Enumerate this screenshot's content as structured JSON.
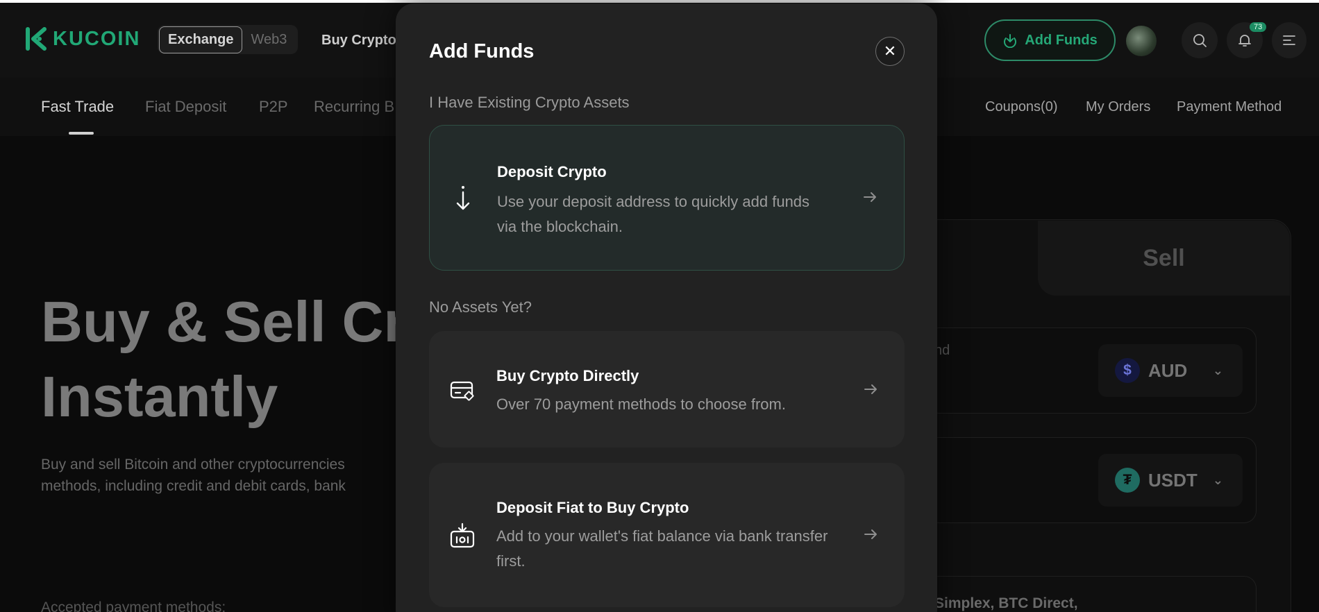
{
  "header": {
    "logo_text": "KUCOIN",
    "switch_exchange": "Exchange",
    "switch_web3": "Web3",
    "nav_buy_crypto": "Buy Crypto",
    "add_funds_label": "Add Funds",
    "notification_count": "73"
  },
  "subnav": {
    "tabs": [
      "Fast Trade",
      "Fiat Deposit",
      "P2P",
      "Recurring B"
    ],
    "active_tab": "Fast Trade",
    "right_links": [
      "Coupons(0)",
      "My Orders",
      "Payment Method"
    ]
  },
  "hero": {
    "title_line1": "Buy & Sell Cr",
    "title_line2": "Instantly",
    "desc_line1": "Buy and sell Bitcoin and other cryptocurrencies",
    "desc_line2": "methods, including credit and debit cards, bank",
    "accepted_label": "Accepted payment methods:"
  },
  "trade_panel": {
    "sell_tab": "Sell",
    "spend_label_fragment": "nd",
    "fiat_currency": "AUD",
    "crypto_currency": "USDT",
    "providers_fragment": "Simplex, BTC Direct,"
  },
  "modal": {
    "title": "Add Funds",
    "section_existing": "I Have Existing Crypto Assets",
    "section_none": "No Assets Yet?",
    "options": [
      {
        "title": "Deposit Crypto",
        "desc": "Use your deposit address to quickly add funds via the blockchain."
      },
      {
        "title": "Buy Crypto Directly",
        "desc": "Over 70 payment methods to choose from."
      },
      {
        "title": "Deposit Fiat to Buy Crypto",
        "desc": "Add to your wallet's fiat balance via bank transfer first."
      }
    ]
  },
  "colors": {
    "brand_green": "#21a876",
    "modal_bg": "#222222",
    "selected_card_bg": "#232b2a"
  }
}
